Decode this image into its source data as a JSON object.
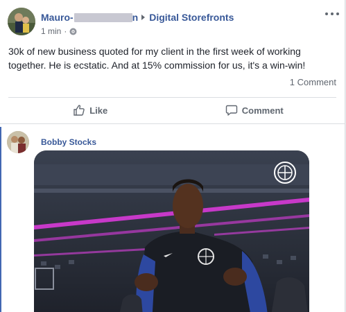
{
  "post": {
    "author_first": "Mauro-",
    "author_tail": "n",
    "group": "Digital Storefronts",
    "time": "1 min",
    "text": "30k of new business quoted for my client in the first week of working together. He is ecstatic. And at 15% commission for us, it's a win-win!",
    "comment_count": "1 Comment"
  },
  "actions": {
    "like_label": "Like",
    "comment_label": "Comment"
  },
  "comment": {
    "author": "Bobby Stocks"
  },
  "colors": {
    "link": "#385898",
    "accent_bar": "#4267b2",
    "arena_pink": "#d83ad8"
  }
}
